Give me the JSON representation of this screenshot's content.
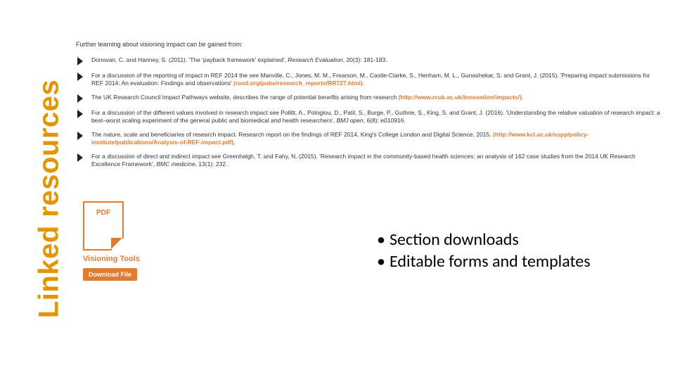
{
  "sidebar": {
    "title": "Linked resources"
  },
  "intro": "Further learning about visioning impact can be gained from:",
  "refs": [
    {
      "pre": "Donovan, C. and Hanney, S. (2011). 'The 'payback framework' explained', ",
      "em": "Research Evaluation",
      "post": ", 20(3): 181-183."
    },
    {
      "pre": "For a discussion of the reporting of impact in REF 2014 the see Manville, C., Jones, M. M., Frearson, M., Castle-Clarke, S., Henham, M. L., Gunashekar, S. and Grant, J. (2015). 'Preparing impact submissions for REF 2014: An evaluation: Findings and observations' ",
      "link": "(rand.org/pubs/research_reports/RR727.html)",
      "post": "."
    },
    {
      "pre": "The UK Research Council Impact Pathways website, describes the range of potential benefits arising from research ",
      "link": "(http://www.rcuk.ac.uk/innovation/impacts/)",
      "post": "."
    },
    {
      "pre": "For a discussion of the different values involved in research impact see Pollitt, A., Potoglou, D., Patil, S., Burge, P., Guthrie, S., King, S. and Grant, J. (2016). 'Understanding the relative valuation of research impact: a best–worst scaling experiment of the general public and biomedical and health researchers', ",
      "em": "BMJ open",
      "post": ", 6(8): e010916."
    },
    {
      "pre": "The nature, scale and beneficiaries of research impact. Research report on the findings of REF 2014, King's College London and Digital Science, 2015. ",
      "link": "(http://www.kcl.ac.uk/sspp/policy-institute/publications/Analysis-of-REF-impact.pdf)",
      "post": "."
    },
    {
      "pre": "For a discussion of direct and indirect impact see Greenhalgh, T. and Fahy, N. (2015). 'Research impact in the community-based health sciences: an analysis of 162 case studies from the 2014 UK Research Excellence Framework', ",
      "em": "BMC medicine",
      "post": ", 13(1): 232."
    }
  ],
  "download": {
    "badge": "PDF",
    "title": "Visioning Tools",
    "button": "Download File"
  },
  "summary": {
    "items": [
      "Section downloads",
      "Editable forms and templates"
    ]
  }
}
